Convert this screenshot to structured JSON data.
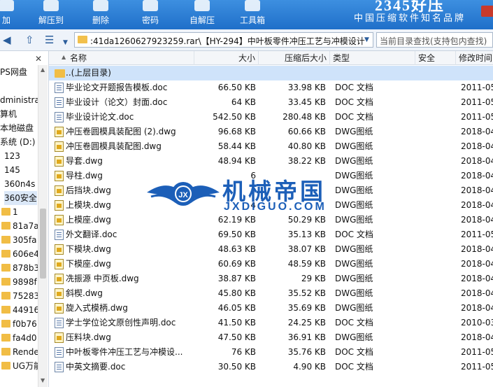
{
  "toolbar": {
    "buttons": [
      {
        "label": "加",
        "icon": "add-icon"
      },
      {
        "label": "解压到",
        "icon": "extract-to-icon"
      },
      {
        "label": "删除",
        "icon": "delete-icon"
      },
      {
        "label": "密码",
        "icon": "password-icon"
      },
      {
        "label": "自解压",
        "icon": "self-extract-icon"
      },
      {
        "label": "工具箱",
        "icon": "toolbox-icon"
      }
    ],
    "brand_top": "2345好压",
    "brand_slogan": "中国压缩软件知名品牌"
  },
  "address": {
    "path": ":41da1260627923259.rar\\【HY-294】中叶板零件冲压工艺与冲模设计",
    "search_placeholder": "当前目录查找(支持包内查找)"
  },
  "sidebar": {
    "items": [
      {
        "label": ""
      },
      {
        "label": "PS网盘"
      },
      {
        "label": ""
      },
      {
        "label": "dministrat"
      },
      {
        "label": "算机"
      },
      {
        "label": "本地磁盘"
      },
      {
        "label": "系统 (D:)"
      },
      {
        "label": "123"
      },
      {
        "label": "145"
      },
      {
        "label": "360n4s"
      },
      {
        "label": "360安全"
      },
      {
        "label": "1"
      },
      {
        "label": "81a7a"
      },
      {
        "label": "305fa"
      },
      {
        "label": "606e4"
      },
      {
        "label": "878b3"
      },
      {
        "label": "9898f"
      },
      {
        "label": "75283"
      },
      {
        "label": "44916"
      },
      {
        "label": "f0b76"
      },
      {
        "label": "fa4d0"
      },
      {
        "label": "Render"
      },
      {
        "label": "UG万能"
      }
    ]
  },
  "columns": {
    "name": "名称",
    "size": "大小",
    "packed": "压缩后大小",
    "type": "类型",
    "security": "安全",
    "modified": "修改时间"
  },
  "parent_dir": "..(上层目录)",
  "files": [
    {
      "name": "毕业论文开题报告模板.doc",
      "size": "66.50 KB",
      "packed": "33.98 KB",
      "type": "DOC 文档",
      "modified": "2011-05",
      "kind": "doc"
    },
    {
      "name": "毕业设计（论文）封面.doc",
      "size": "64 KB",
      "packed": "33.45 KB",
      "type": "DOC 文档",
      "modified": "2011-05",
      "kind": "doc"
    },
    {
      "name": "毕业设计论文.doc",
      "size": "542.50 KB",
      "packed": "280.48 KB",
      "type": "DOC 文档",
      "modified": "2011-05",
      "kind": "doc"
    },
    {
      "name": "冲压卷圆模具装配图 (2).dwg",
      "size": "96.68 KB",
      "packed": "60.66 KB",
      "type": "DWG图纸",
      "modified": "2018-04",
      "kind": "dwg"
    },
    {
      "name": "冲压卷圆模具装配图.dwg",
      "size": "58.44 KB",
      "packed": "40.80 KB",
      "type": "DWG图纸",
      "modified": "2018-04",
      "kind": "dwg"
    },
    {
      "name": "导套.dwg",
      "size": "48.94 KB",
      "packed": "38.22 KB",
      "type": "DWG图纸",
      "modified": "2018-04",
      "kind": "dwg"
    },
    {
      "name": "导柱.dwg",
      "size": "6",
      "packed": "",
      "type": "DWG图纸",
      "modified": "2018-04",
      "kind": "dwg"
    },
    {
      "name": "后挡块.dwg",
      "size": "",
      "packed": "",
      "type": "DWG图纸",
      "modified": "2018-04",
      "kind": "dwg"
    },
    {
      "name": "上模块.dwg",
      "size": "4",
      "packed": "",
      "type": "DWG图纸",
      "modified": "2018-04",
      "kind": "dwg"
    },
    {
      "name": "上模座.dwg",
      "size": "62.19 KB",
      "packed": "50.29 KB",
      "type": "DWG图纸",
      "modified": "2018-04",
      "kind": "dwg"
    },
    {
      "name": "外文翻译.doc",
      "size": "69.50 KB",
      "packed": "35.13 KB",
      "type": "DOC 文档",
      "modified": "2011-05",
      "kind": "doc"
    },
    {
      "name": "下模块.dwg",
      "size": "48.63 KB",
      "packed": "38.07 KB",
      "type": "DWG图纸",
      "modified": "2018-04",
      "kind": "dwg"
    },
    {
      "name": "下模座.dwg",
      "size": "60.69 KB",
      "packed": "48.59 KB",
      "type": "DWG图纸",
      "modified": "2018-04",
      "kind": "dwg"
    },
    {
      "name": "冼振源 中页板.dwg",
      "size": "38.87 KB",
      "packed": "29 KB",
      "type": "DWG图纸",
      "modified": "2018-04",
      "kind": "dwg"
    },
    {
      "name": "斜楔.dwg",
      "size": "45.80 KB",
      "packed": "35.52 KB",
      "type": "DWG图纸",
      "modified": "2018-04",
      "kind": "dwg"
    },
    {
      "name": "旋入式模柄.dwg",
      "size": "46.05 KB",
      "packed": "35.69 KB",
      "type": "DWG图纸",
      "modified": "2018-04",
      "kind": "dwg"
    },
    {
      "name": "学士学位论文原创性声明.doc",
      "size": "41.50 KB",
      "packed": "24.25 KB",
      "type": "DOC 文档",
      "modified": "2010-03",
      "kind": "doc"
    },
    {
      "name": "压料块.dwg",
      "size": "47.50 KB",
      "packed": "36.91 KB",
      "type": "DWG图纸",
      "modified": "2018-04",
      "kind": "dwg"
    },
    {
      "name": "中叶板零件冲压工艺与冲模设...",
      "size": "76 KB",
      "packed": "35.76 KB",
      "type": "DOC 文档",
      "modified": "2011-05",
      "kind": "doc"
    },
    {
      "name": "中英文摘要.doc",
      "size": "30.50 KB",
      "packed": "4.90 KB",
      "type": "DOC 文档",
      "modified": "2011-05",
      "kind": "doc"
    }
  ],
  "watermark": {
    "title": "机械帝国",
    "subtitle": "JXDIGUO.COM",
    "emblem_letters": "JX"
  },
  "colors": {
    "toolbar_blue": "#2a7ad6",
    "watermark_blue": "#1c5fb8",
    "selection": "#cfe3fa"
  }
}
